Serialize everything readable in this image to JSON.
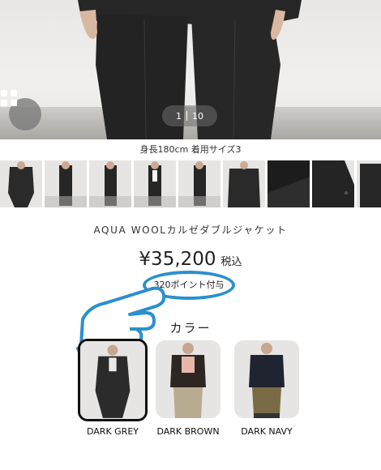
{
  "hero": {
    "pager_current": "1",
    "pager_total": "10"
  },
  "model_info": "身長180cm 着用サイズ3",
  "product": {
    "name": "AQUA WOOLカルゼダブルジャケット",
    "price": "¥35,200",
    "tax_label": "税込",
    "points": "320ポイント付与"
  },
  "color_section": {
    "title": "カラー",
    "options": [
      {
        "label": "DARK GREY",
        "selected": true
      },
      {
        "label": "DARK BROWN",
        "selected": false
      },
      {
        "label": "DARK NAVY",
        "selected": false
      }
    ]
  },
  "colors": {
    "accent_ring": "#2a8fd0",
    "garment": "#2b2b2b"
  },
  "icons": [
    "grid-icon",
    "pointing-hand-icon"
  ]
}
